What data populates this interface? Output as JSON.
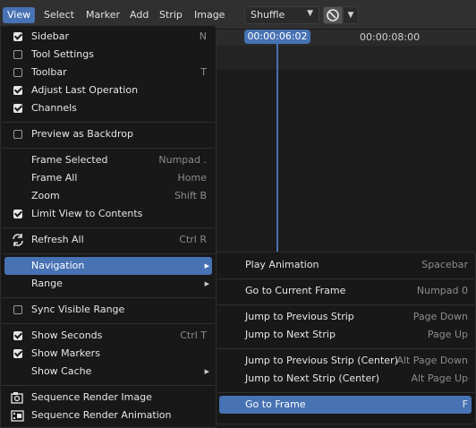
{
  "header": {
    "menus": [
      "View",
      "Select",
      "Marker",
      "Add",
      "Strip",
      "Image"
    ],
    "active_menu": "View",
    "overlap_mode": "Shuffle"
  },
  "timeline": {
    "current_frame_time": "00:00:06:02",
    "ruler_time": "00:00:08:00"
  },
  "view_menu": {
    "items": [
      {
        "label": "Sidebar",
        "shortcut": "N",
        "checked": true
      },
      {
        "label": "Tool Settings",
        "shortcut": "",
        "checked": false
      },
      {
        "label": "Toolbar",
        "shortcut": "T",
        "checked": false
      },
      {
        "label": "Adjust Last Operation",
        "shortcut": "",
        "checked": true
      },
      {
        "label": "Channels",
        "shortcut": "",
        "checked": true
      },
      {
        "label": "Preview as Backdrop",
        "shortcut": "",
        "checked": false
      },
      {
        "label": "Frame Selected",
        "shortcut": "Numpad ."
      },
      {
        "label": "Frame All",
        "shortcut": "Home"
      },
      {
        "label": "Zoom",
        "shortcut": "Shift B"
      },
      {
        "label": "Limit View to Contents",
        "shortcut": "",
        "checked": true
      },
      {
        "label": "Refresh All",
        "shortcut": "Ctrl R",
        "icon": "refresh-icon"
      },
      {
        "label": "Navigation",
        "submenu": true,
        "highlighted": true
      },
      {
        "label": "Range",
        "submenu": true
      },
      {
        "label": "Sync Visible Range",
        "shortcut": "",
        "checked": false
      },
      {
        "label": "Show Seconds",
        "shortcut": "Ctrl T",
        "checked": true
      },
      {
        "label": "Show Markers",
        "shortcut": "",
        "checked": true
      },
      {
        "label": "Show Cache",
        "submenu": true
      },
      {
        "label": "Sequence Render Image",
        "icon": "render-still-icon"
      },
      {
        "label": "Sequence Render Animation",
        "icon": "render-animation-icon"
      }
    ]
  },
  "navigation_menu": {
    "items": [
      {
        "label": "Play Animation",
        "shortcut": "Spacebar"
      },
      {
        "label": "Go to Current Frame",
        "shortcut": "Numpad 0"
      },
      {
        "label": "Jump to Previous Strip",
        "shortcut": "Page Down"
      },
      {
        "label": "Jump to Next Strip",
        "shortcut": "Page Up"
      },
      {
        "label": "Jump to Previous Strip (Center)",
        "shortcut": "Alt Page Down"
      },
      {
        "label": "Jump to Next Strip (Center)",
        "shortcut": "Alt Page Up"
      },
      {
        "label": "Go to Frame",
        "shortcut": "F",
        "highlighted": true
      }
    ]
  },
  "colors": {
    "accent": "#4772b3",
    "menu_bg": "#181818",
    "header_bg": "#303030"
  }
}
